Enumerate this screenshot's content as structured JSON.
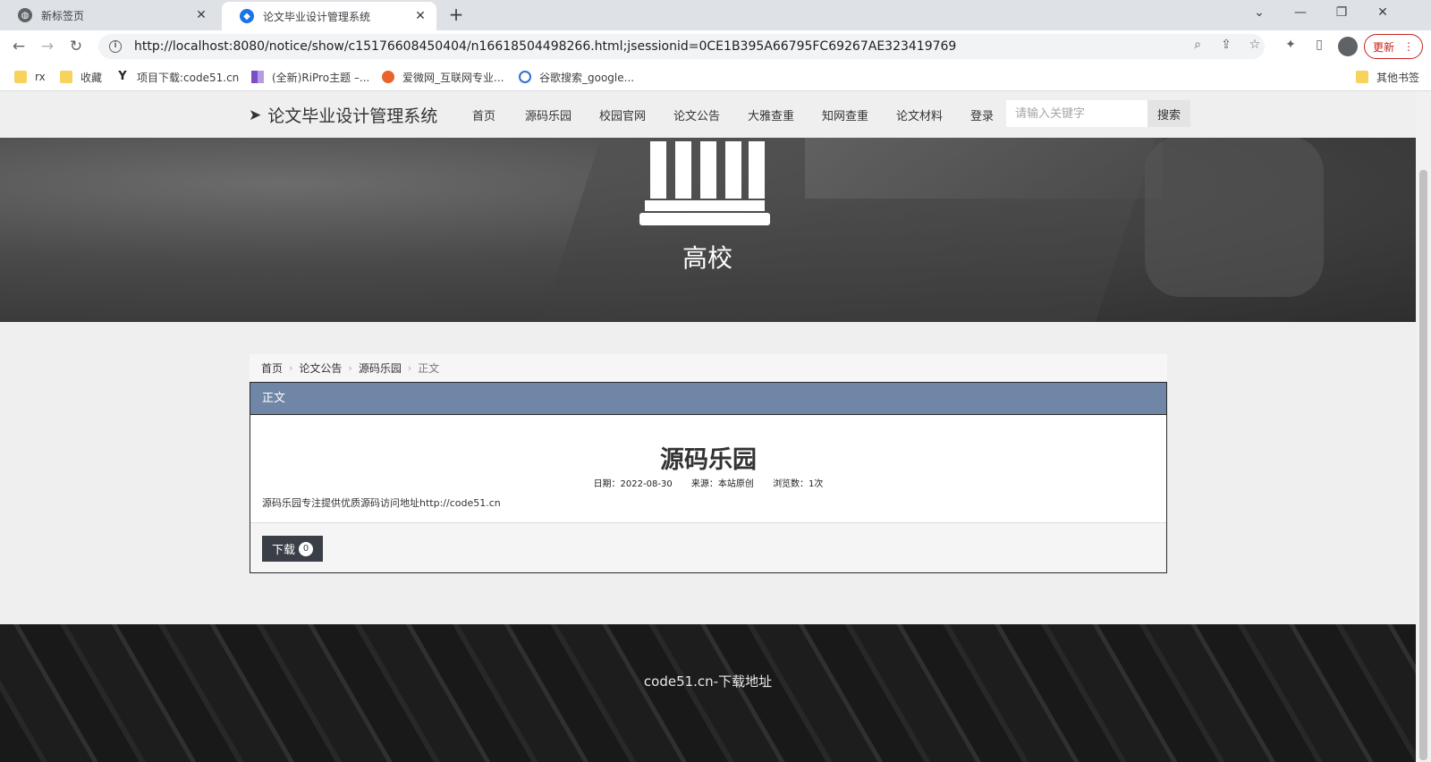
{
  "tabs": [
    {
      "title": "新标签页"
    },
    {
      "title": "论文毕业设计管理系统"
    }
  ],
  "address_bar": {
    "url": "http://localhost:8080/notice/show/c15176608450404/n16618504498266.html;jsessionid=0CE1B395A66795FC69267AE323419769"
  },
  "update_button": {
    "label": "更新"
  },
  "bookmarks": [
    {
      "label": "rx",
      "icon": "folder-icon"
    },
    {
      "label": "收藏",
      "icon": "folder-icon"
    },
    {
      "label": "项目下载:code51.cn",
      "icon": "y-logo-icon"
    },
    {
      "label": "(全新)RiPro主题 –...",
      "icon": "grid-logo-icon"
    },
    {
      "label": "爱微网_互联网专业...",
      "icon": "love-logo-icon"
    },
    {
      "label": "谷歌搜索_google...",
      "icon": "360-logo-icon"
    }
  ],
  "other_bookmarks": {
    "label": "其他书签"
  },
  "site": {
    "brand": "论文毕业设计管理系统",
    "nav": [
      "首页",
      "源码乐园",
      "校园官网",
      "论文公告",
      "大雅查重",
      "知网查重",
      "论文材料",
      "登录"
    ],
    "search_placeholder": "请输入关键字",
    "search_button": "搜索",
    "hero_title": "高校"
  },
  "breadcrumb": [
    "首页",
    "论文公告",
    "源码乐园",
    "正文"
  ],
  "article": {
    "panel_heading": "正文",
    "title": "源码乐园",
    "date": "日期：2022-08-30",
    "source": "来源：本站原创",
    "views": "浏览数：1次",
    "body": "源码乐园专注提供优质源码访问地址http://code51.cn",
    "download_label": "下载",
    "download_count": "0"
  },
  "footer": {
    "text": "code51.cn-下载地址"
  },
  "colors": {
    "panel_header": "#6f86a6",
    "download_button": "#3a3f47",
    "update_accent": "#c5221f"
  }
}
